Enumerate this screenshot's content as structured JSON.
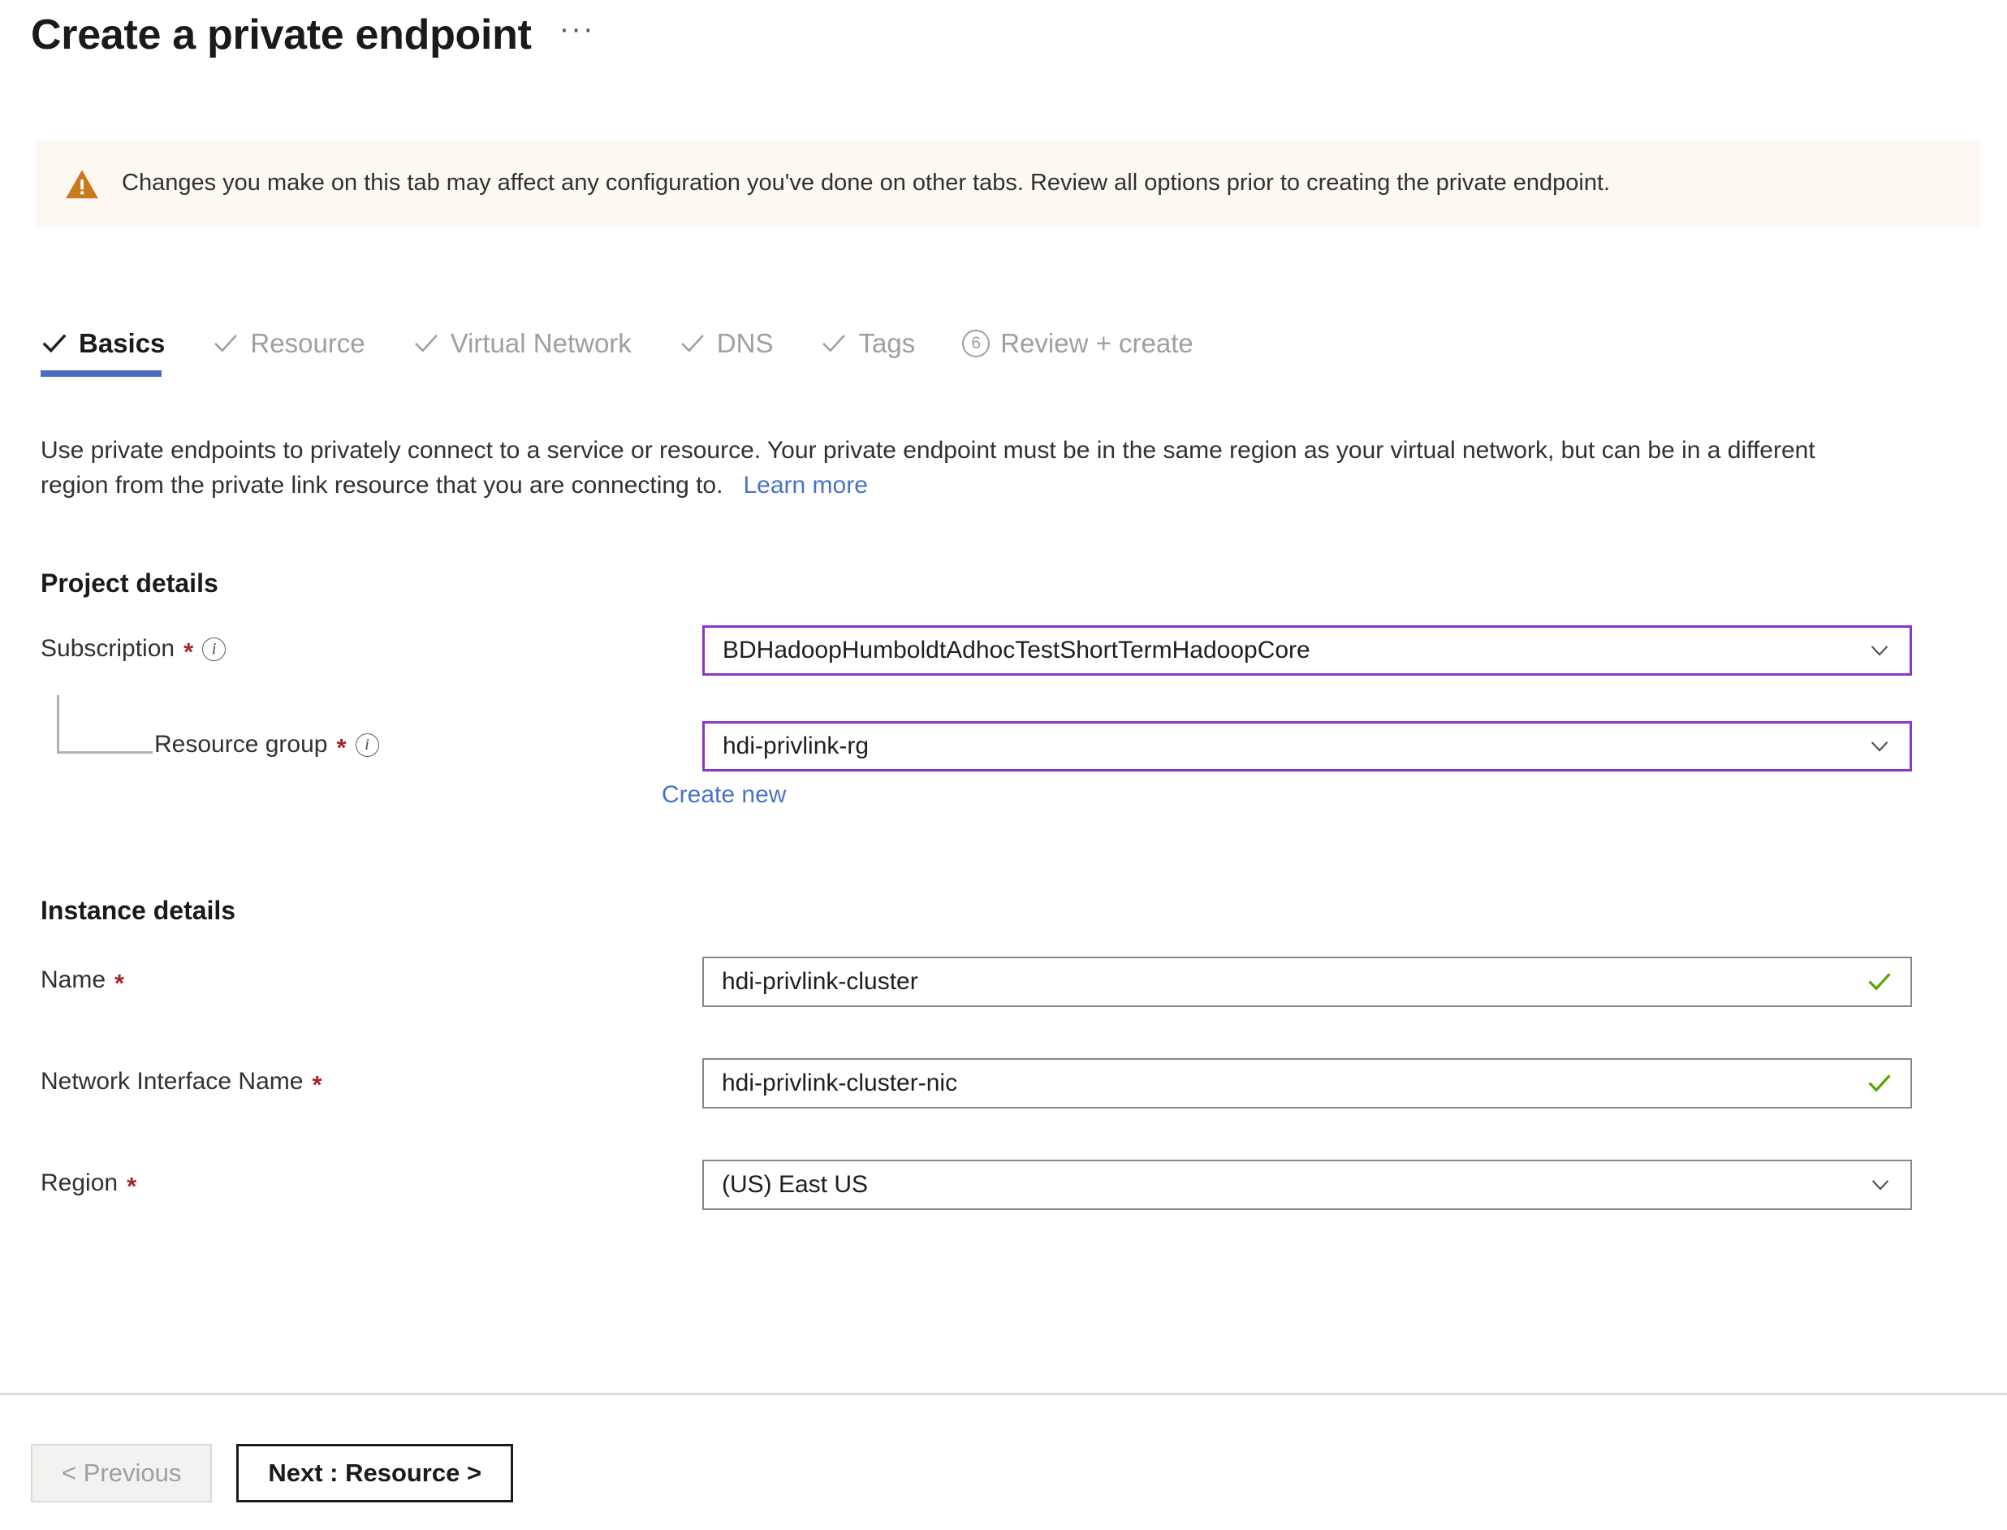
{
  "header": {
    "title": "Create a private endpoint",
    "more_menu": "···"
  },
  "banner": {
    "icon": "warning-triangle-icon",
    "color": "#C77A1E",
    "background": "#FDF8F2",
    "text": "Changes you make on this tab may affect any configuration you've done on other tabs. Review all options prior to creating the private endpoint."
  },
  "tabs": {
    "accent_color": "#4C6BBD",
    "items": [
      {
        "label": "Basics",
        "marker": "check",
        "state": "active"
      },
      {
        "label": "Resource",
        "marker": "check",
        "state": "complete"
      },
      {
        "label": "Virtual Network",
        "marker": "check",
        "state": "complete"
      },
      {
        "label": "DNS",
        "marker": "check",
        "state": "complete"
      },
      {
        "label": "Tags",
        "marker": "check",
        "state": "complete"
      },
      {
        "label": "Review + create",
        "marker": "6",
        "state": "pending"
      }
    ]
  },
  "description": {
    "text": "Use private endpoints to privately connect to a service or resource. Your private endpoint must be in the same region as your virtual network, but can be in a different region from the private link resource that you are connecting to.",
    "link_label": "Learn more",
    "link_color": "#4A73C8"
  },
  "project_details": {
    "heading": "Project details",
    "subscription": {
      "label": "Subscription",
      "required": "*",
      "info": "i",
      "value": "BDHadoopHumboldtAdhocTestShortTermHadoopCore",
      "border_color": "#8A36C9",
      "control": "dropdown"
    },
    "resource_group": {
      "label": "Resource group",
      "required": "*",
      "info": "i",
      "value": "hdi-privlink-rg",
      "border_color": "#8A36C9",
      "control": "dropdown",
      "create_new_label": "Create new"
    }
  },
  "instance_details": {
    "heading": "Instance details",
    "fields": [
      {
        "label": "Name",
        "required": "*",
        "value": "hdi-privlink-cluster",
        "control": "textbox",
        "validation": "valid",
        "border_color": "#8A8886"
      },
      {
        "label": "Network Interface Name",
        "required": "*",
        "value": "hdi-privlink-cluster-nic",
        "control": "textbox",
        "validation": "valid",
        "border_color": "#8A8886"
      },
      {
        "label": "Region",
        "required": "*",
        "value": "(US) East US",
        "control": "dropdown",
        "validation": "none",
        "border_color": "#8A8886"
      }
    ]
  },
  "footer": {
    "previous_label": "< Previous",
    "previous_state": "disabled",
    "next_label": "Next : Resource >",
    "next_state": "enabled"
  }
}
